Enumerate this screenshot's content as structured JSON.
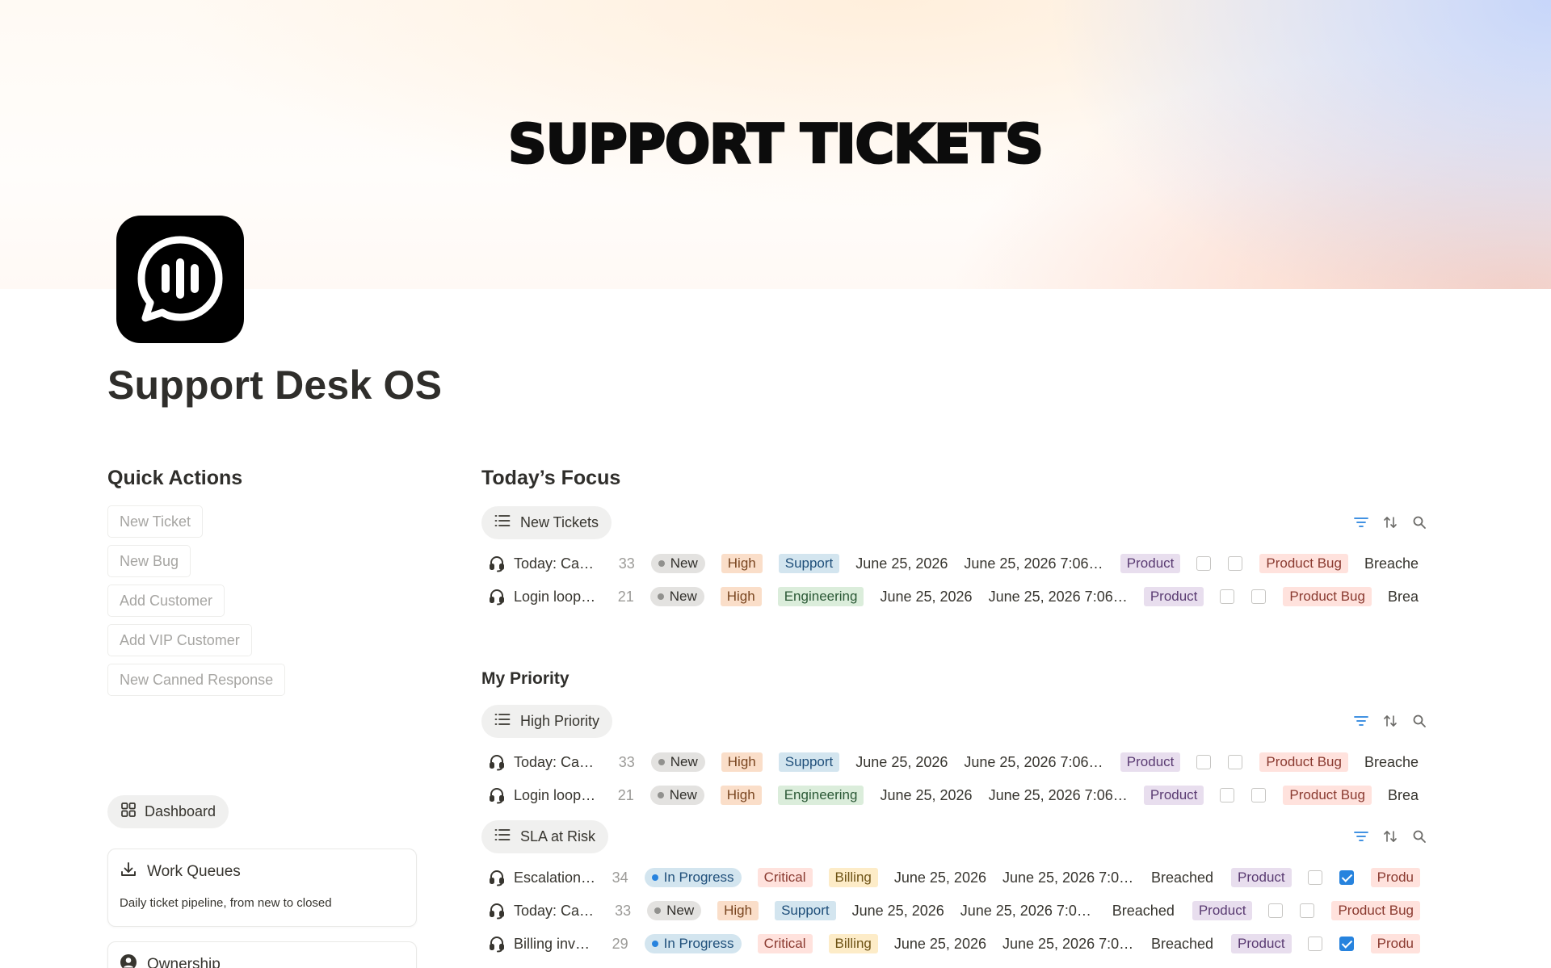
{
  "cover": {
    "title": "SUPPORT TICKETS"
  },
  "page": {
    "title": "Support Desk OS",
    "icon": "support-chat-icon"
  },
  "quick_actions": {
    "title": "Quick Actions",
    "buttons": [
      "New Ticket",
      "New Bug",
      "Add Customer",
      "Add VIP Customer",
      "New Canned Response"
    ]
  },
  "dashboard": {
    "tab_label": "Dashboard",
    "cards": [
      {
        "title": "Work Queues",
        "description": "Daily ticket pipeline, from new to closed",
        "icon": "download-icon"
      },
      {
        "title": "Ownership",
        "icon": "person-icon"
      }
    ]
  },
  "colors": {
    "new_bg": "#e3e2e0",
    "new_dot": "#91918e",
    "progress_bg": "#d3e5ef",
    "progress_dot": "#2783de",
    "high_bg": "#fadec9",
    "critical_bg": "#ffe2dd",
    "support_bg": "#d3e5ef",
    "engineering_bg": "#dbeddb",
    "billing_bg": "#fdecc8",
    "product_bg": "#e8deee",
    "bug_bg": "#ffe2dd"
  },
  "todays_focus": {
    "title": "Today’s Focus",
    "view": {
      "label": "New Tickets"
    },
    "rows": [
      {
        "name": "Today: Ca…",
        "num": "33",
        "status": "New",
        "priority": "High",
        "team": "Support",
        "date": "June 25, 2026",
        "datetime": "June 25, 2026 7:06…",
        "product": "Product",
        "cb1": false,
        "cb2": false,
        "category": "Product Bug",
        "sla": "Breache"
      },
      {
        "name": "Login loop…",
        "num": "21",
        "status": "New",
        "priority": "High",
        "team": "Engineering",
        "date": "June 25, 2026",
        "datetime": "June 25, 2026 7:06…",
        "product": "Product",
        "cb1": false,
        "cb2": false,
        "category": "Product Bug",
        "sla": "Brea"
      }
    ]
  },
  "my_priority": {
    "title": "My Priority",
    "high_view": {
      "label": "High Priority"
    },
    "high_rows": [
      {
        "name": "Today: Ca…",
        "num": "33",
        "status": "New",
        "priority": "High",
        "team": "Support",
        "date": "June 25, 2026",
        "datetime": "June 25, 2026 7:06…",
        "product": "Product",
        "cb1": false,
        "cb2": false,
        "category": "Product Bug",
        "sla": "Breache"
      },
      {
        "name": "Login loop…",
        "num": "21",
        "status": "New",
        "priority": "High",
        "team": "Engineering",
        "date": "June 25, 2026",
        "datetime": "June 25, 2026 7:06…",
        "product": "Product",
        "cb1": false,
        "cb2": false,
        "category": "Product Bug",
        "sla": "Brea"
      }
    ],
    "sla_view": {
      "label": "SLA at Risk"
    },
    "sla_rows": [
      {
        "name": "Escalation…",
        "num": "34",
        "status": "In Progress",
        "priority": "Critical",
        "team": "Billing",
        "date": "June 25, 2026",
        "datetime": "June 25, 2026 7:06…",
        "sla": "Breached",
        "product": "Product",
        "cb1": false,
        "cb2": true,
        "category": "Produ"
      },
      {
        "name": "Today: Ca…",
        "num": "33",
        "status": "New",
        "priority": "High",
        "team": "Support",
        "date": "June 25, 2026",
        "datetime": "June 25, 2026 7:06…",
        "sla": "Breached",
        "product": "Product",
        "cb1": false,
        "cb2": false,
        "category": "Product Bug"
      },
      {
        "name": "Billing inv…",
        "num": "29",
        "status": "In Progress",
        "priority": "Critical",
        "team": "Billing",
        "date": "June 25, 2026",
        "datetime": "June 25, 2026 7:06…",
        "sla": "Breached",
        "product": "Product",
        "cb1": false,
        "cb2": true,
        "category": "Produ"
      }
    ]
  }
}
